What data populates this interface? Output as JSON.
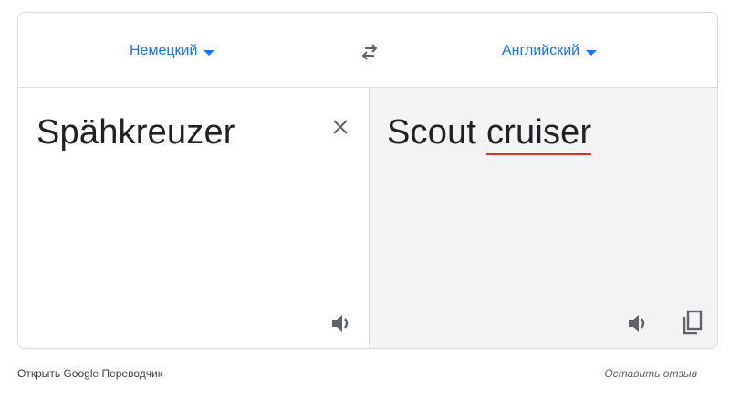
{
  "header": {
    "source_language": "Немецкий",
    "target_language": "Английский"
  },
  "source": {
    "text": "Spähkreuzer"
  },
  "translation": {
    "word1": "Scout ",
    "word2": "cruiser"
  },
  "footer": {
    "open_link": "Открыть Google Переводчик",
    "feedback": "Оставить отзыв"
  },
  "colors": {
    "accent": "#1a73e8",
    "spell_underline": "#d93025",
    "target_pane_bg": "#f1f3f4",
    "icon": "#5f6368"
  },
  "icons": {
    "swap": "swap-arrows-icon",
    "clear": "close-icon",
    "speak": "speaker-icon",
    "copy": "copy-icon"
  }
}
